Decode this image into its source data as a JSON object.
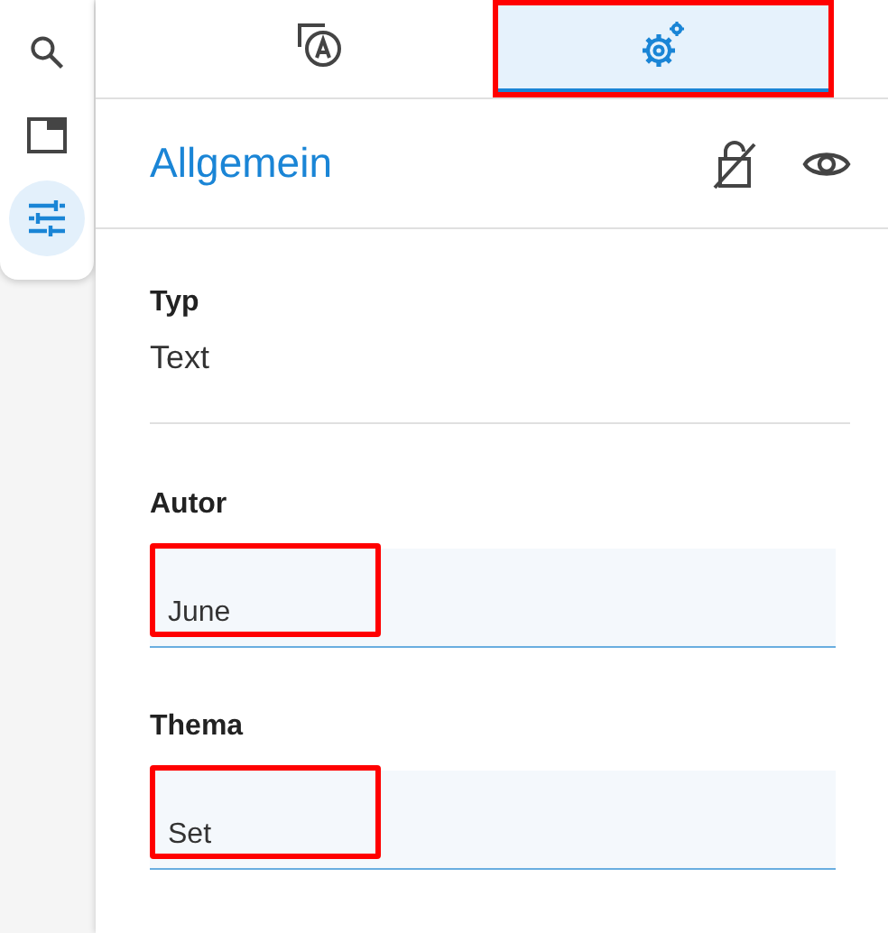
{
  "rail": [
    {
      "kind": "search",
      "selected": false
    },
    {
      "kind": "window",
      "selected": false
    },
    {
      "kind": "sliders",
      "selected": true
    }
  ],
  "tabs": [
    {
      "kind": "text-style",
      "selected": false,
      "highlighted": false
    },
    {
      "kind": "gears",
      "selected": true,
      "highlighted": true
    }
  ],
  "section": {
    "title": "Allgemein"
  },
  "type": {
    "label": "Typ",
    "value": "Text"
  },
  "fields": [
    {
      "label": "Autor",
      "value": "June",
      "highlighted": true
    },
    {
      "label": "Thema",
      "value": "Set",
      "highlighted": true
    }
  ]
}
